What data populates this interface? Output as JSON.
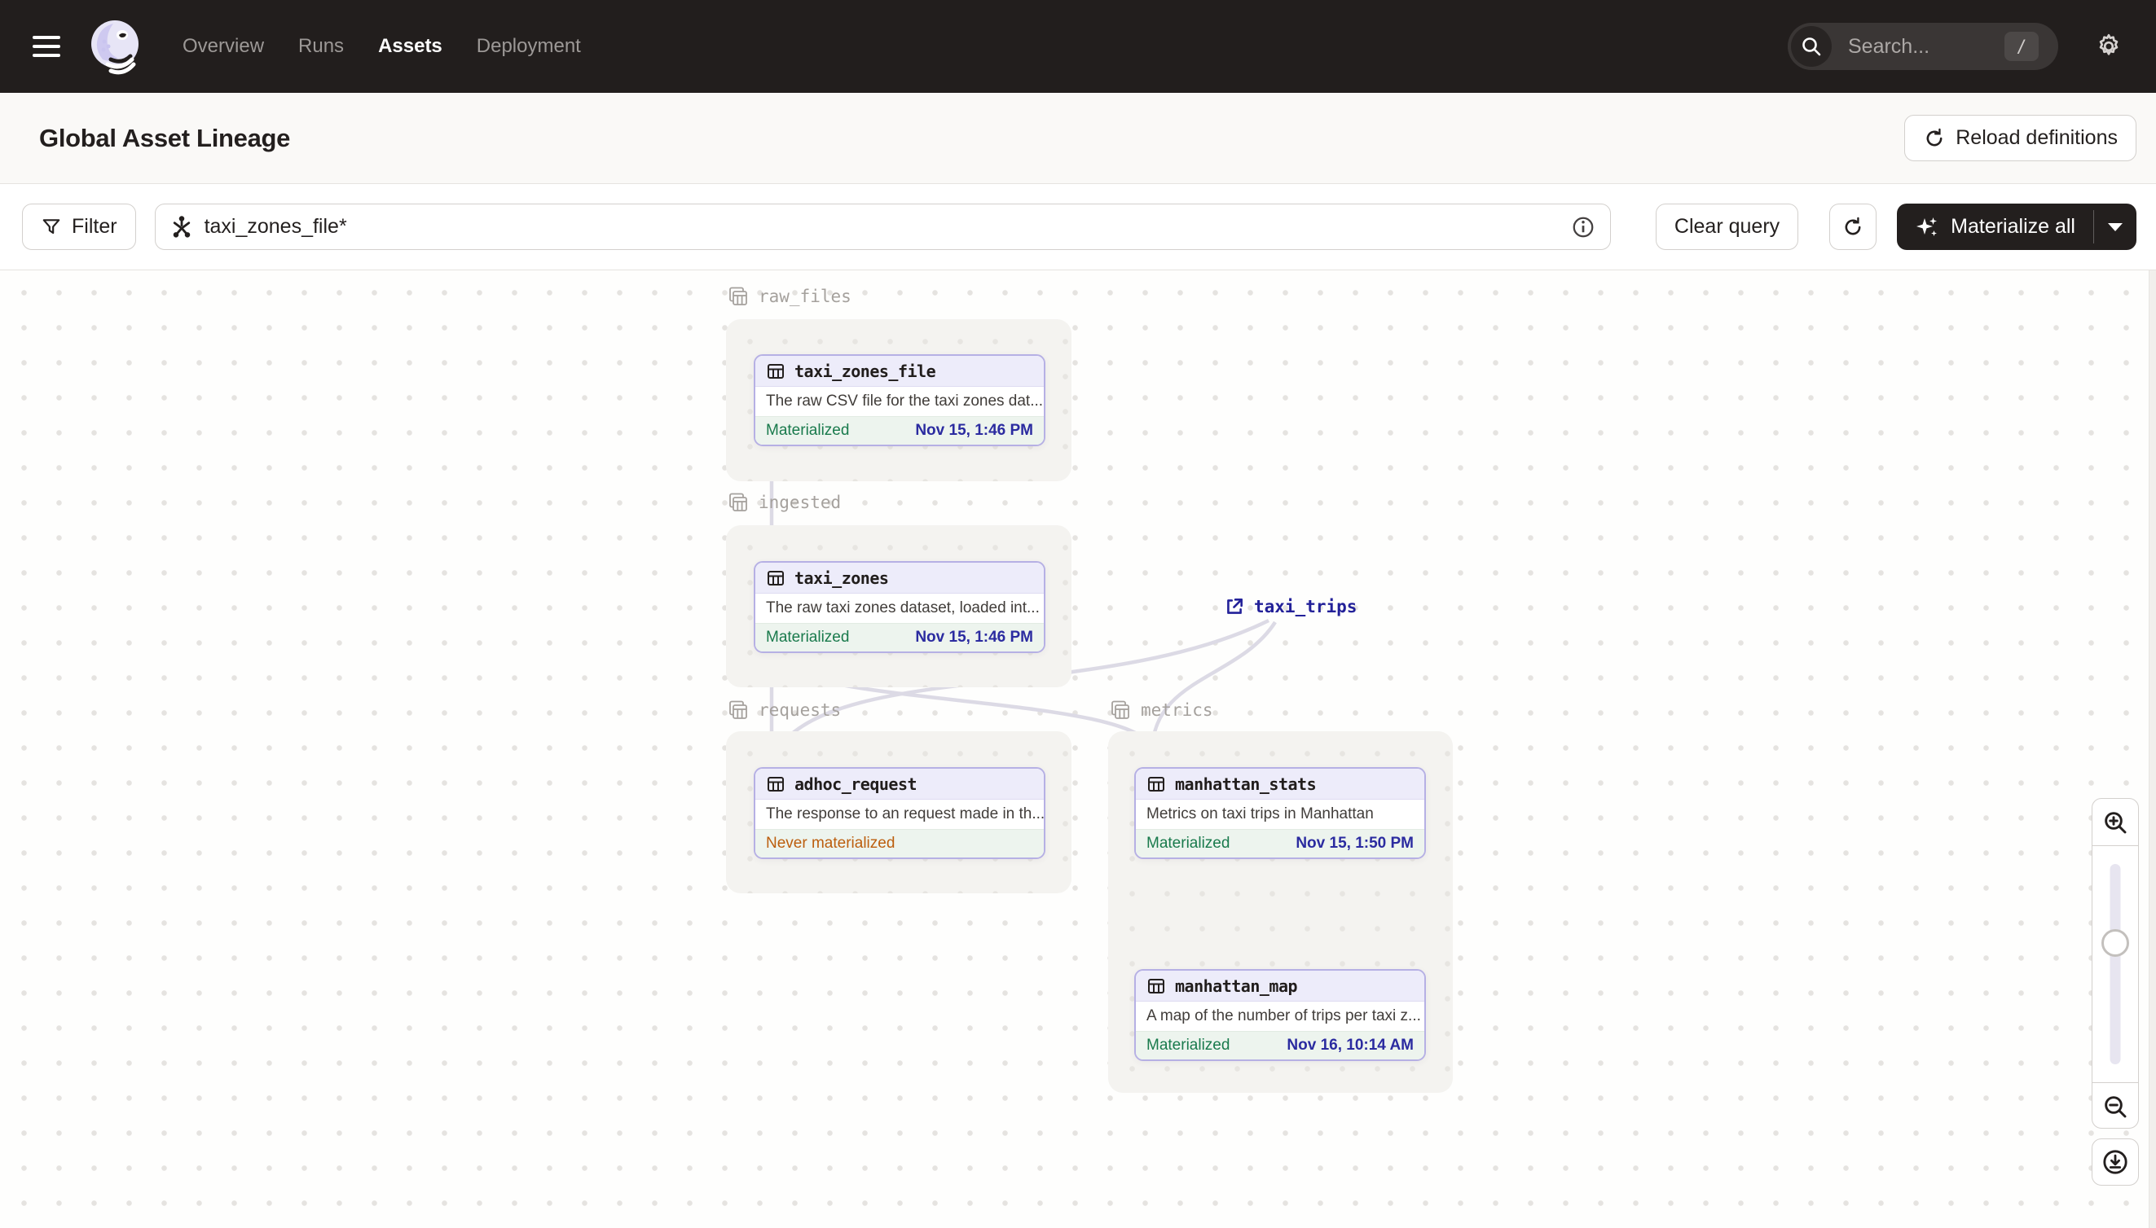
{
  "navbar": {
    "items": [
      {
        "label": "Overview",
        "active": false
      },
      {
        "label": "Runs",
        "active": false
      },
      {
        "label": "Assets",
        "active": true
      },
      {
        "label": "Deployment",
        "active": false
      }
    ],
    "search_placeholder": "Search...",
    "search_shortcut": "/"
  },
  "header": {
    "title": "Global Asset Lineage",
    "reload_label": "Reload definitions"
  },
  "toolbar": {
    "filter_label": "Filter",
    "query_value": "taxi_zones_file*",
    "clear_label": "Clear query",
    "materialize_label": "Materialize all"
  },
  "graph": {
    "groups": [
      {
        "name": "raw_files"
      },
      {
        "name": "ingested"
      },
      {
        "name": "requests"
      },
      {
        "name": "metrics"
      }
    ],
    "nodes": [
      {
        "name": "taxi_zones_file",
        "description": "The raw CSV file for the taxi zones dat...",
        "status": "Materialized",
        "timestamp": "Nov 15, 1:46 PM",
        "group": "raw_files"
      },
      {
        "name": "taxi_zones",
        "description": "The raw taxi zones dataset, loaded int...",
        "status": "Materialized",
        "timestamp": "Nov 15, 1:46 PM",
        "group": "ingested"
      },
      {
        "name": "adhoc_request",
        "description": "The response to an request made in th...",
        "status": "Never materialized",
        "timestamp": "",
        "group": "requests"
      },
      {
        "name": "manhattan_stats",
        "description": "Metrics on taxi trips in Manhattan",
        "status": "Materialized",
        "timestamp": "Nov 15, 1:50 PM",
        "group": "metrics"
      },
      {
        "name": "manhattan_map",
        "description": "A map of the number of trips per taxi z...",
        "status": "Materialized",
        "timestamp": "Nov 16, 10:14 AM",
        "group": "metrics"
      }
    ],
    "external_nodes": [
      {
        "name": "taxi_trips"
      }
    ]
  },
  "icons": {
    "menu": "hamburger-icon",
    "logo": "dagster-logo",
    "search": "magnifier-icon",
    "settings": "gear-icon",
    "reload": "refresh-icon",
    "filter": "funnel-icon",
    "query": "asset-selection-icon",
    "info": "info-icon",
    "materialize": "sparkle-icon",
    "asset": "table-icon",
    "group": "stacked-tables-icon",
    "external": "external-link-icon",
    "zoom_in": "zoom-in-icon",
    "zoom_out": "zoom-out-icon",
    "download": "download-icon"
  },
  "colors": {
    "navbar_bg": "#221E1D",
    "accent_lavender": "#B6B0E4",
    "node_header_bg": "#EDECFA",
    "materialized_green": "#197A4C",
    "never_materialized_orange": "#BC5E0E",
    "timestamp_navy": "#2B2BA0",
    "edge_gray": "#DCDAE5"
  }
}
